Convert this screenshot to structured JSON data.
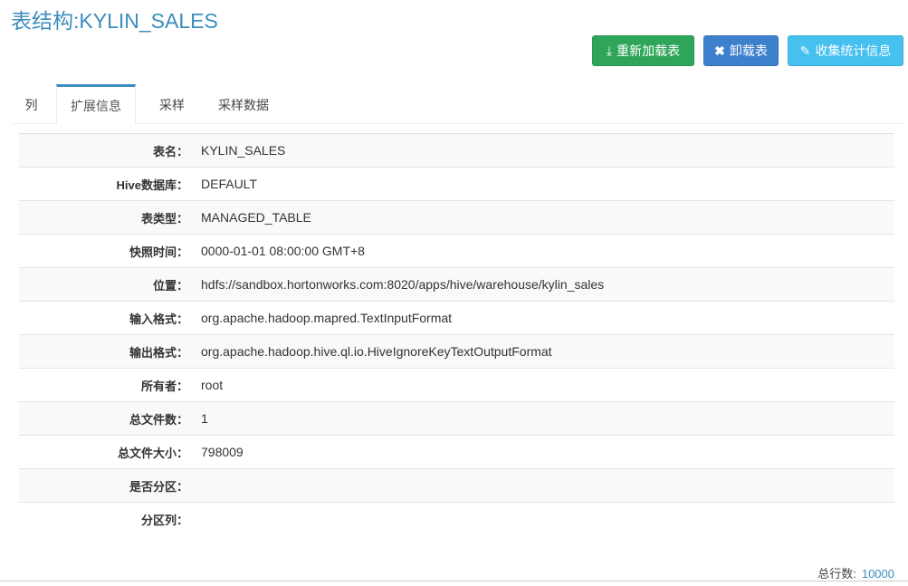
{
  "title": "表结构:KYLIN_SALES",
  "buttons": {
    "reload": "重新加载表",
    "unload": "卸载表",
    "collect": "收集统计信息"
  },
  "tabs": [
    "列",
    "扩展信息",
    "采样",
    "采样数据"
  ],
  "active_tab": "扩展信息",
  "rows": [
    {
      "label": "表名：",
      "value": "KYLIN_SALES"
    },
    {
      "label": "Hive数据库：",
      "value": "DEFAULT"
    },
    {
      "label": "表类型：",
      "value": "MANAGED_TABLE"
    },
    {
      "label": "快照时间：",
      "value": "0000-01-01 08:00:00 GMT+8"
    },
    {
      "label": "位置：",
      "value": "hdfs://sandbox.hortonworks.com:8020/apps/hive/warehouse/kylin_sales"
    },
    {
      "label": "输入格式：",
      "value": "org.apache.hadoop.mapred.TextInputFormat"
    },
    {
      "label": "输出格式：",
      "value": "org.apache.hadoop.hive.ql.io.HiveIgnoreKeyTextOutputFormat"
    },
    {
      "label": "所有者：",
      "value": "root"
    },
    {
      "label": "总文件数：",
      "value": "1"
    },
    {
      "label": "总文件大小：",
      "value": "798009"
    },
    {
      "label": "是否分区：",
      "value": ""
    },
    {
      "label": "分区列：",
      "value": ""
    }
  ],
  "footer": {
    "label": "总行数:",
    "value": "10000"
  }
}
